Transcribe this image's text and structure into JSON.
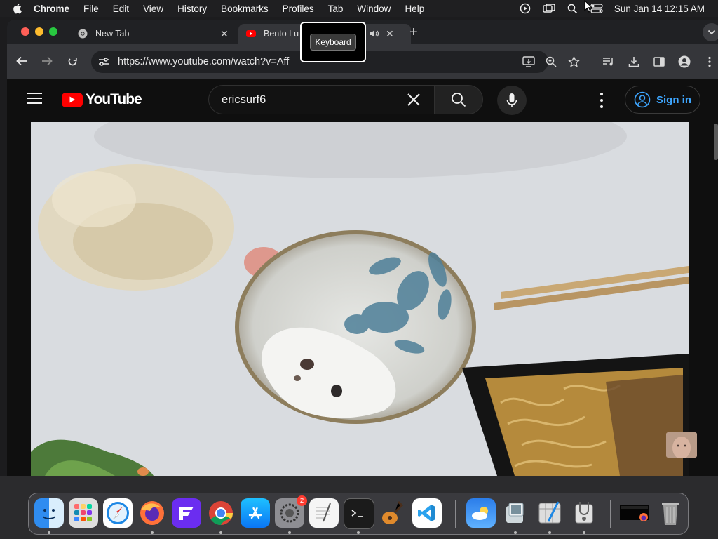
{
  "menubar": {
    "app": "Chrome",
    "items": [
      "File",
      "Edit",
      "View",
      "History",
      "Bookmarks",
      "Profiles",
      "Tab",
      "Window",
      "Help"
    ],
    "clock": "Sun Jan 14  12:15 AM",
    "icons": [
      "play-circle-icon",
      "screen-mirroring-icon",
      "spotlight-search-icon",
      "control-center-icon"
    ]
  },
  "browser": {
    "tabs": [
      {
        "title": "New Tab",
        "icon": "chrome-icon",
        "active": false
      },
      {
        "title": "Bento Lu",
        "icon": "youtube-favicon",
        "active": true,
        "audio": true
      }
    ],
    "tooltip": "Keyboard",
    "url": "https://www.youtube.com/watch?v=Aff",
    "toolbar_icons": [
      "install-app-icon",
      "zoom-icon",
      "bookmark-star-icon",
      "media-queue-icon",
      "download-icon",
      "side-panel-icon",
      "profile-icon",
      "more-menu-icon"
    ]
  },
  "youtube": {
    "logo": "YouTube",
    "search_query": "ericsurf6",
    "sign_in": "Sign in",
    "colors": {
      "brand_red": "#ff0000",
      "link_blue": "#3ea6ff"
    }
  },
  "video": {
    "scene": "Overhead cooking video still"
  },
  "dock": {
    "apps": [
      {
        "name": "finder",
        "running": true
      },
      {
        "name": "launchpad",
        "running": false
      },
      {
        "name": "safari",
        "running": false
      },
      {
        "name": "firefox",
        "running": true
      },
      {
        "name": "fleet",
        "running": false
      },
      {
        "name": "chrome",
        "running": true
      },
      {
        "name": "app-store",
        "running": false
      },
      {
        "name": "system-settings",
        "running": true,
        "badge": "2"
      },
      {
        "name": "textedit",
        "running": false
      },
      {
        "name": "terminal",
        "running": true
      },
      {
        "name": "garageband",
        "running": false
      },
      {
        "name": "vscode",
        "running": false
      },
      {
        "name": "weather",
        "running": false
      },
      {
        "name": "preview",
        "running": true
      },
      {
        "name": "script-editor",
        "running": true
      },
      {
        "name": "disk-utility",
        "running": true
      },
      {
        "name": "minimized-window",
        "running": false
      },
      {
        "name": "trash",
        "running": false
      }
    ]
  }
}
